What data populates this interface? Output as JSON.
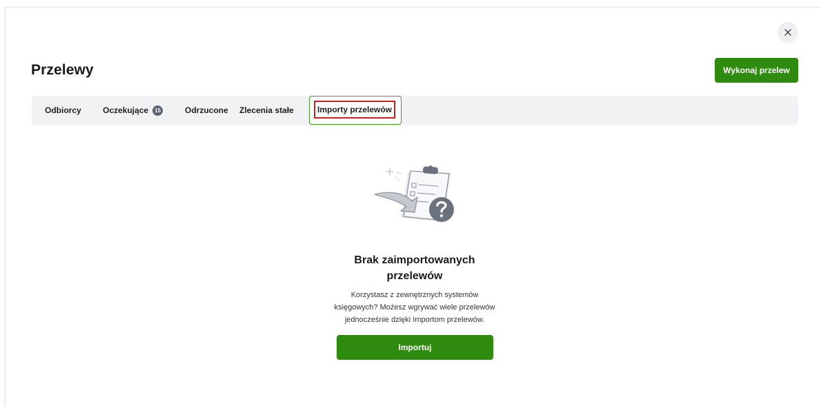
{
  "header": {
    "title": "Przelewy",
    "primary_action_label": "Wykonaj przelew",
    "close_icon": "close-icon"
  },
  "tabs": [
    {
      "label": "Odbiorcy"
    },
    {
      "label": "Oczekujące",
      "badge": "15"
    },
    {
      "label": "Odrzucone"
    },
    {
      "label": "Zlecenia stałe"
    },
    {
      "label": "Importy przelewów",
      "active": true
    }
  ],
  "empty_state": {
    "illustration_icon": "clipboard-question-icon",
    "title_line1": "Brak zaimportowanych",
    "title_line2": "przelewów",
    "description_line1": "Korzystasz z zewnętrznych systemów",
    "description_line2": "księgowych? Możesz wgrywać wiele przelewów",
    "description_line3": "jednocześnie dzięki Importom przelewów.",
    "button_label": "Importuj"
  },
  "colors": {
    "primary": "#2e8b10",
    "tab_bar_bg": "#f1f2f4",
    "active_tab_border": "#3c9b1d",
    "highlight_border": "#d01f1f",
    "badge_bg": "#5a6270"
  }
}
